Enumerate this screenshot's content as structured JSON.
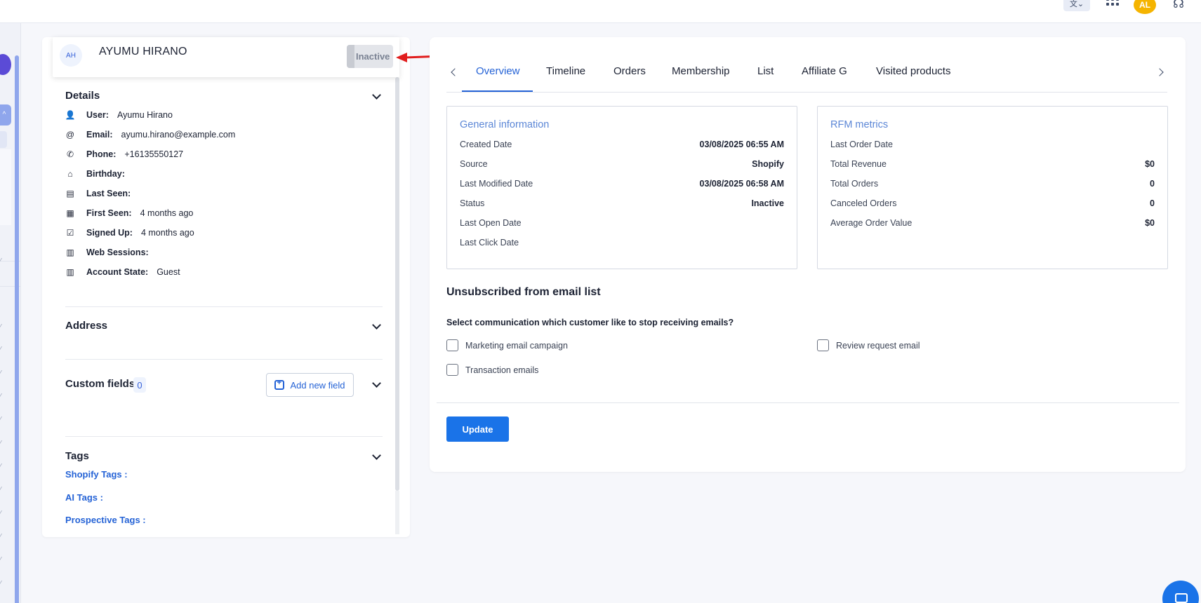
{
  "topbar": {
    "translate_icon": "translate-icon",
    "apps_icon": "apps-grid-icon",
    "user_initials": "AL",
    "support_icon": "support-headset-icon"
  },
  "customer": {
    "initials": "AH",
    "name": "AYUMU HIRANO",
    "status_toggle": "Inactive"
  },
  "details": {
    "title": "Details",
    "rows": [
      {
        "icon": "user-icon",
        "glyph": "👤",
        "label": "User:",
        "value": "Ayumu Hirano"
      },
      {
        "icon": "at-icon",
        "glyph": "@",
        "label": "Email:",
        "value": "ayumu.hirano@example.com"
      },
      {
        "icon": "phone-icon",
        "glyph": "✆",
        "label": "Phone:",
        "value": "+16135550127"
      },
      {
        "icon": "birthday-cake-icon",
        "glyph": "⌂",
        "label": "Birthday:",
        "value": ""
      },
      {
        "icon": "id-card-icon",
        "glyph": "▤",
        "label": "Last Seen:",
        "value": ""
      },
      {
        "icon": "calendar-icon",
        "glyph": "▦",
        "label": "First Seen:",
        "value": "4 months ago"
      },
      {
        "icon": "calendar-check-icon",
        "glyph": "☑",
        "label": "Signed Up:",
        "value": "4 months ago"
      },
      {
        "icon": "bar-chart-icon",
        "glyph": "▥",
        "label": "Web Sessions:",
        "value": ""
      },
      {
        "icon": "bar-chart-icon",
        "glyph": "▥",
        "label": "Account State:",
        "value": "Guest"
      }
    ]
  },
  "address": {
    "title": "Address"
  },
  "custom_fields": {
    "title": "Custom fields",
    "count": "0",
    "add_label": "Add new field"
  },
  "tags": {
    "title": "Tags",
    "shopify": "Shopify Tags :",
    "ai": "AI Tags :",
    "prospective": "Prospective Tags :"
  },
  "tabs": [
    "Overview",
    "Timeline",
    "Orders",
    "Membership",
    "List",
    "Affiliate G",
    "Visited products"
  ],
  "active_tab": "Overview",
  "general_info": {
    "title": "General information",
    "rows": [
      {
        "label": "Created Date",
        "value": "03/08/2025 06:55 AM"
      },
      {
        "label": "Source",
        "value": "Shopify"
      },
      {
        "label": "Last Modified Date",
        "value": "03/08/2025 06:58 AM"
      },
      {
        "label": "Status",
        "value": "Inactive"
      },
      {
        "label": "Last Open Date",
        "value": ""
      },
      {
        "label": "Last Click Date",
        "value": ""
      }
    ]
  },
  "rfm": {
    "title": "RFM metrics",
    "rows": [
      {
        "label": "Last Order Date",
        "value": ""
      },
      {
        "label": "Total Revenue",
        "value": "$0"
      },
      {
        "label": "Total Orders",
        "value": "0"
      },
      {
        "label": "Canceled Orders",
        "value": "0"
      },
      {
        "label": "Average Order Value",
        "value": "$0"
      }
    ]
  },
  "unsubscribe": {
    "title": "Unsubscribed from email list",
    "question": "Select communication which customer like to stop receiving emails?",
    "options": [
      {
        "label": "Marketing email campaign",
        "checked": false
      },
      {
        "label": "Review request email",
        "checked": false
      },
      {
        "label": "Transaction emails",
        "checked": false
      }
    ],
    "update_label": "Update"
  },
  "colors": {
    "accent": "#1a73e8",
    "link": "#2563d6",
    "card_title": "#5b86d6",
    "avatar": "#f5b400",
    "annotation_arrow": "#e11d1d"
  }
}
